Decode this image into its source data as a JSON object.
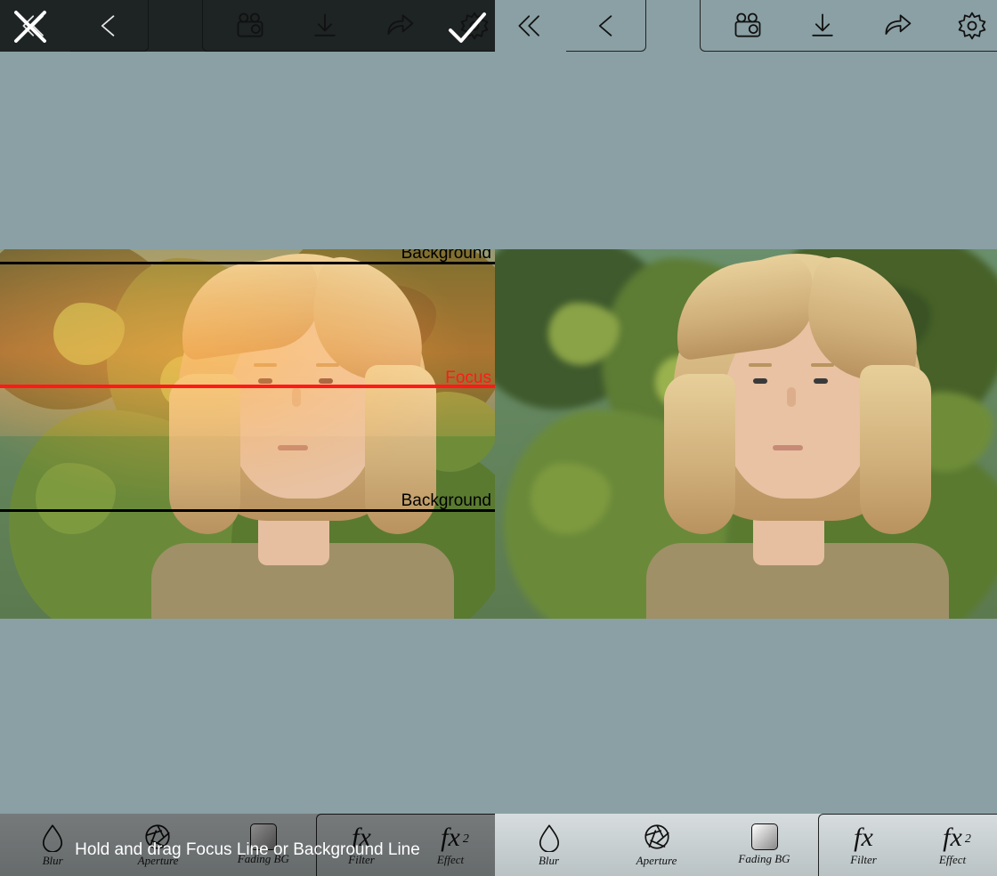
{
  "left": {
    "topbar": {
      "close": "close",
      "back": "back"
    },
    "overlay": {
      "bg_top_label": "Background",
      "focus_label": "Focus",
      "bg_bottom_label": "Background"
    },
    "hint": "Hold and drag Focus Line or Background Line",
    "tools": {
      "blur": "Blur",
      "aperture": "Aperture",
      "fading": "Fading BG",
      "filter": "Filter",
      "effect": "Effect"
    }
  },
  "right": {
    "tools": {
      "blur": "Blur",
      "aperture": "Aperture",
      "fading": "Fading BG",
      "filter": "Filter",
      "effect": "Effect"
    }
  }
}
